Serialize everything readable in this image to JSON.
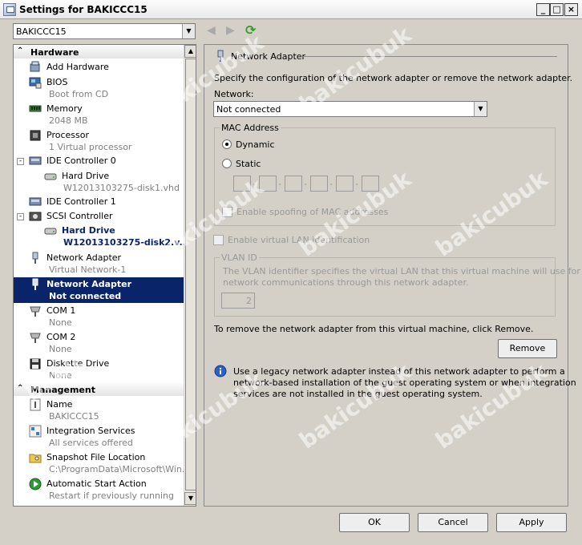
{
  "window": {
    "title": "Settings for BAKICCC15"
  },
  "vm_select": {
    "value": "BAKICCC15"
  },
  "tree": {
    "hardware_label": "Hardware",
    "management_label": "Management",
    "items": [
      {
        "label": "Add Hardware",
        "sub": ""
      },
      {
        "label": "BIOS",
        "sub": "Boot from CD"
      },
      {
        "label": "Memory",
        "sub": "2048 MB"
      },
      {
        "label": "Processor",
        "sub": "1 Virtual processor"
      },
      {
        "label": "IDE Controller 0",
        "sub": ""
      },
      {
        "label": "Hard Drive",
        "sub": "W12013103275-disk1.vhd"
      },
      {
        "label": "IDE Controller 1",
        "sub": ""
      },
      {
        "label": "SCSI Controller",
        "sub": ""
      },
      {
        "label": "Hard Drive",
        "sub": "W12013103275-disk2.v..."
      },
      {
        "label": "Network Adapter",
        "sub": "Virtual Network-1"
      },
      {
        "label": "Network Adapter",
        "sub": "Not connected"
      },
      {
        "label": "COM 1",
        "sub": "None"
      },
      {
        "label": "COM 2",
        "sub": "None"
      },
      {
        "label": "Diskette Drive",
        "sub": "None"
      }
    ],
    "mgmt_items": [
      {
        "label": "Name",
        "sub": "BAKICCC15"
      },
      {
        "label": "Integration Services",
        "sub": "All services offered"
      },
      {
        "label": "Snapshot File Location",
        "sub": "C:\\ProgramData\\Microsoft\\Win..."
      },
      {
        "label": "Automatic Start Action",
        "sub": "Restart if previously running"
      }
    ]
  },
  "panel": {
    "header": "Network Adapter",
    "description": "Specify the configuration of the network adapter or remove the network adapter.",
    "network_label": "Network:",
    "network_value": "Not connected",
    "mac_group": "MAC Address",
    "dynamic": "Dynamic",
    "static": "Static",
    "mac_sep": "-",
    "spoofing": "Enable spoofing of MAC addresses",
    "vlan_check": "Enable virtual LAN identification",
    "vlan_group": "VLAN ID",
    "vlan_desc_1": "The VLAN identifier specifies the virtual LAN that this virtual machine will use for all",
    "vlan_desc_2": "network communications through this network adapter.",
    "vlan_value": "2",
    "remove_text": "To remove the network adapter from this virtual machine, click Remove.",
    "remove_btn": "Remove",
    "info_1": "Use a legacy network adapter instead of this network adapter to perform a",
    "info_2": "network-based installation of the guest operating system or when integration",
    "info_3": "services are not installed in the guest operating system."
  },
  "buttons": {
    "ok": "OK",
    "cancel": "Cancel",
    "apply": "Apply"
  },
  "watermark": "bakicubuk",
  "colors": {
    "selection": "#0a246a",
    "window": "#d4d0c8",
    "refresh": "#3a9a2a"
  }
}
